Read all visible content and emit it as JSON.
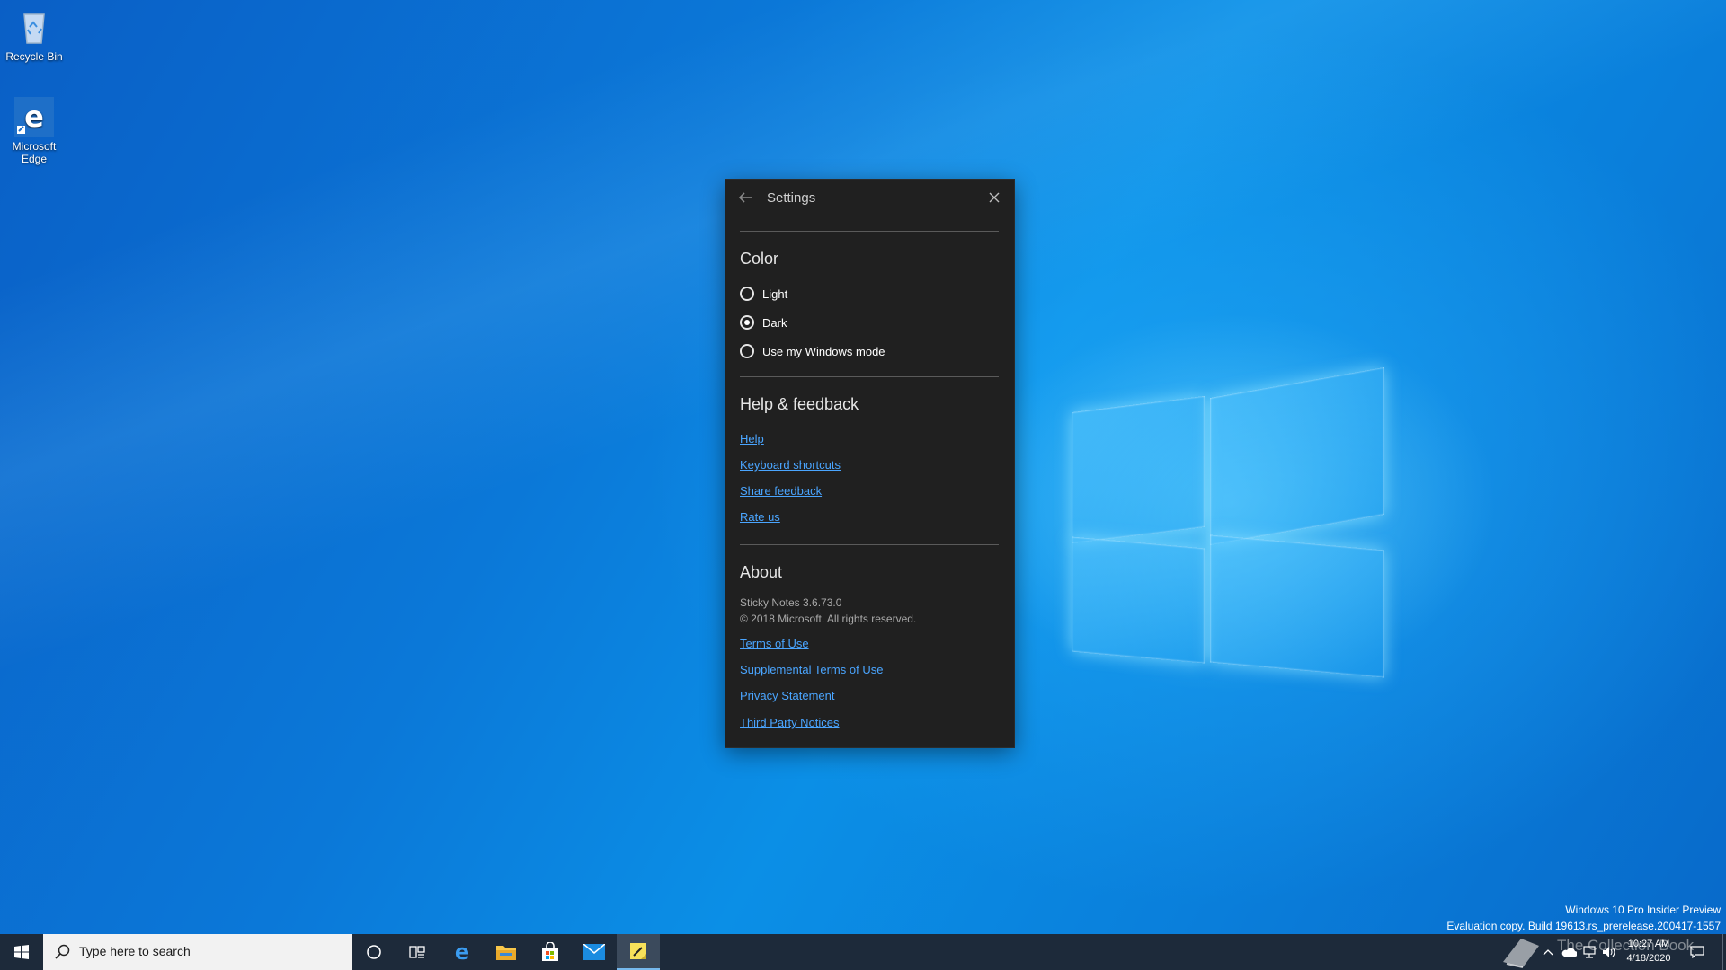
{
  "desktop": {
    "icons": [
      {
        "label": "Recycle Bin",
        "icon": "recycle-bin-icon"
      },
      {
        "label": "Microsoft Edge",
        "icon": "edge-icon"
      }
    ]
  },
  "settings": {
    "title": "Settings",
    "color_section": {
      "heading": "Color",
      "options": [
        {
          "label": "Light",
          "selected": false
        },
        {
          "label": "Dark",
          "selected": true
        },
        {
          "label": "Use my Windows mode",
          "selected": false
        }
      ]
    },
    "help_section": {
      "heading": "Help & feedback",
      "links": [
        "Help",
        "Keyboard shortcuts",
        "Share feedback",
        "Rate us"
      ]
    },
    "about_section": {
      "heading": "About",
      "version": "Sticky Notes 3.6.73.0",
      "copyright": "© 2018 Microsoft. All rights reserved.",
      "links": [
        "Terms of Use",
        "Supplemental Terms of Use",
        "Privacy Statement",
        "Third Party Notices"
      ]
    },
    "colors": {
      "background": "#202020",
      "link": "#4aa5ff"
    }
  },
  "taskbar": {
    "search_placeholder": "Type here to search",
    "apps": [
      "start-icon",
      "cortana-icon",
      "task-view-icon",
      "edge-icon",
      "file-explorer-icon",
      "store-icon",
      "mail-icon",
      "sticky-notes-icon"
    ],
    "active_app": "Sticky Notes"
  },
  "system": {
    "watermark_line1": "Windows 10 Pro Insider Preview",
    "watermark_line2": "Evaluation copy. Build 19613.rs_prerelease.200417-1557",
    "time": "10:27 AM",
    "date": "4/18/2020",
    "overlay_text": "The Collection Book"
  }
}
